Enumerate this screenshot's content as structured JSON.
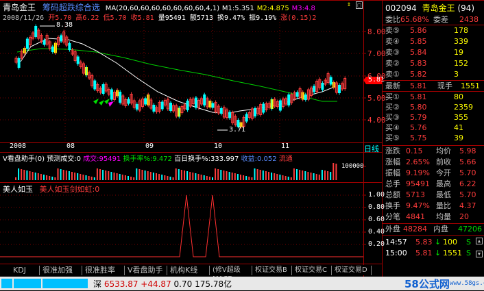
{
  "chart_title": "青岛金王",
  "indicator_name": "筹码超跌综合选",
  "ma_label": "MA(20,60,60,60,60,60,60,60,4,1)",
  "ma_values": {
    "m1": "M1:5.351",
    "m2": "M2:4.875",
    "m3": "M3:4.8"
  },
  "date_label": "2008/11/26",
  "ohlc": {
    "open": "开5.70",
    "high": "高6.22",
    "low": "低5.70",
    "close": "收5.81",
    "volume": "量95491",
    "amount": "额5713",
    "turnover": "换9.47%",
    "amplitude": "振9.19%",
    "change": "涨(0.15)2"
  },
  "price_axis": [
    "8.00",
    "7.00",
    "6.00",
    "5.00",
    "4.00"
  ],
  "price_annotations": {
    "high": "8.38",
    "low": "3.71",
    "current": "5.81"
  },
  "month_labels": [
    "2008",
    "08",
    "09",
    "10",
    "11"
  ],
  "period_label": "日线",
  "sub1": {
    "name": "V看盘助手(0)",
    "forecast": "预测成交:0",
    "deal": "成交:95491",
    "turnover": "换手率%:9.472",
    "hundred_day": "百日换手%:333.997",
    "gain": "收益:0.052",
    "flow": "流通",
    "axis_max": "100000"
  },
  "sub2": {
    "name": "美人如玉",
    "signal": "美人如玉剑如虹:0",
    "axis": [
      "1.00",
      "0.80",
      "0.60",
      "0.40",
      "0.20"
    ]
  },
  "tabs": [
    "KDJ",
    "很准加强",
    "很准胜率",
    "V看盘助手",
    "机构K线",
    "(修V超级MACD",
    "权证交易B",
    "权证交易C",
    "权证交易D"
  ],
  "status_bar": {
    "index": "深",
    "value": "6533.87",
    "change": "+44.87",
    "pct": "0.70",
    "amount": "175.78亿"
  },
  "watermark": "58公式网",
  "watermark_url": "www.58gs.com",
  "quote": {
    "code": "002094",
    "name": "青岛金王",
    "rank": "(94)",
    "weibi_label": "委比",
    "weibi_value": "65.68%",
    "weicha_label": "委差",
    "weicha_value": "2438",
    "sells": [
      {
        "label": "卖⑤",
        "price": "5.86",
        "vol": "178"
      },
      {
        "label": "卖④",
        "price": "5.85",
        "vol": "339"
      },
      {
        "label": "卖③",
        "price": "5.84",
        "vol": "19"
      },
      {
        "label": "卖②",
        "price": "5.83",
        "vol": "152"
      },
      {
        "label": "卖①",
        "price": "5.82",
        "vol": "3"
      }
    ],
    "latest_label": "最新",
    "latest_value": "5.81",
    "now_vol_label": "现手",
    "now_vol": "1551",
    "buys": [
      {
        "label": "买①",
        "price": "5.81",
        "vol": "80"
      },
      {
        "label": "买②",
        "price": "5.80",
        "vol": "2359"
      },
      {
        "label": "买③",
        "price": "5.79",
        "vol": "355"
      },
      {
        "label": "买④",
        "price": "5.76",
        "vol": "41"
      },
      {
        "label": "买⑤",
        "price": "5.75",
        "vol": "39"
      }
    ],
    "stats": [
      {
        "l1": "涨跌",
        "v1": "0.15",
        "l2": "均价",
        "v2": "5.98"
      },
      {
        "l1": "涨幅",
        "v1": "2.65%",
        "l2": "前收",
        "v2": "5.66"
      },
      {
        "l1": "振幅",
        "v1": "9.19%",
        "l2": "今开",
        "v2": "5.70"
      },
      {
        "l1": "总手",
        "v1": "95491",
        "l2": "最高",
        "v2": "6.22"
      },
      {
        "l1": "总额",
        "v1": "5713",
        "l2": "最低",
        "v2": "5.70"
      },
      {
        "l1": "换手",
        "v1": "9.47%",
        "l2": "量比",
        "v2": "4.37"
      },
      {
        "l1": "分笔",
        "v1": "4841",
        "l2": "均量",
        "v2": "20"
      }
    ],
    "outer_label": "外盘",
    "outer": "48284",
    "inner_label": "内盘",
    "inner": "47206",
    "ticks": [
      {
        "time": "14:57",
        "price": "5.83",
        "dir": "↓",
        "vol": "100",
        "side": "S"
      },
      {
        "time": "15:00",
        "price": "5.81",
        "dir": "↓",
        "vol": "1551",
        "side": "S"
      }
    ]
  }
}
